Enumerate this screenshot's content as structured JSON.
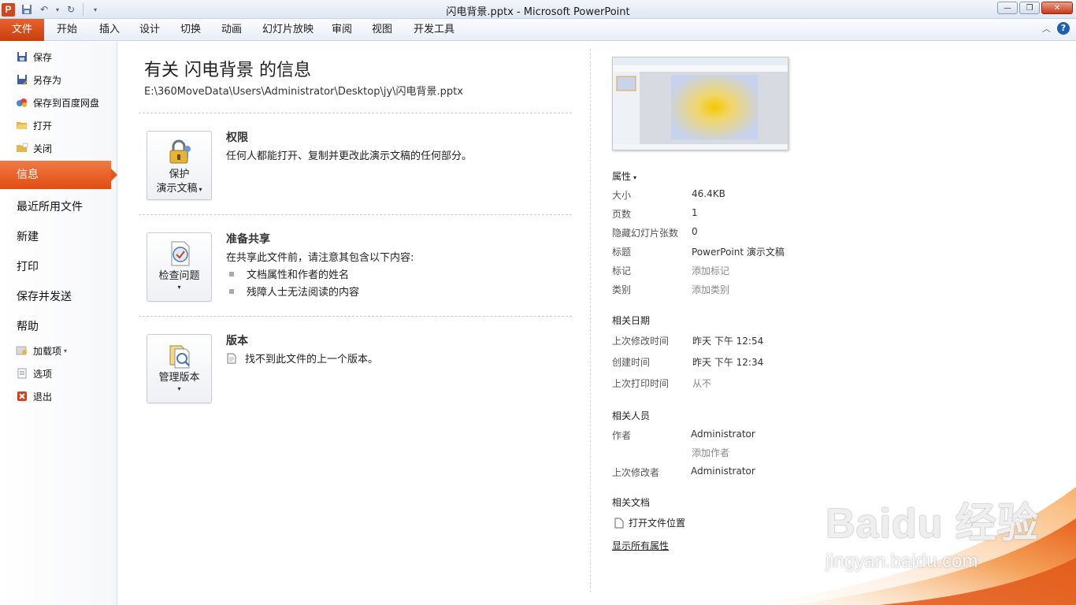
{
  "window": {
    "title": "闪电背景.pptx  -  Microsoft PowerPoint",
    "app_icon_letter": "P"
  },
  "ribbon": {
    "file_tab": "文件",
    "tabs": [
      "开始",
      "插入",
      "设计",
      "切换",
      "动画",
      "幻灯片放映",
      "审阅",
      "视图",
      "开发工具"
    ]
  },
  "leftnav": {
    "small_top": [
      {
        "label": "保存",
        "icon": "save-icon"
      },
      {
        "label": "另存为",
        "icon": "save-as-icon"
      },
      {
        "label": "保存到百度网盘",
        "icon": "baidu-cloud-icon"
      },
      {
        "label": "打开",
        "icon": "open-folder-icon"
      },
      {
        "label": "关闭",
        "icon": "close-folder-icon"
      }
    ],
    "active": "信息",
    "big": [
      "最近所用文件",
      "新建",
      "打印",
      "保存并发送",
      "帮助"
    ],
    "small_bottom": [
      {
        "label": "加载项",
        "icon": "addins-icon"
      },
      {
        "label": "选项",
        "icon": "options-icon"
      },
      {
        "label": "退出",
        "icon": "exit-icon"
      }
    ]
  },
  "info": {
    "heading": "有关 闪电背景 的信息",
    "path": "E:\\360MoveData\\Users\\Administrator\\Desktop\\jy\\闪电背景.pptx",
    "permissions": {
      "button_line1": "保护",
      "button_line2": "演示文稿",
      "title": "权限",
      "text": "任何人都能打开、复制并更改此演示文稿的任何部分。"
    },
    "share": {
      "button": "检查问题",
      "title": "准备共享",
      "text": "在共享此文件前，请注意其包含以下内容:",
      "bullets": [
        "文档属性和作者的姓名",
        "残障人士无法阅读的内容"
      ]
    },
    "versions": {
      "button": "管理版本",
      "title": "版本",
      "text": "找不到此文件的上一个版本。"
    }
  },
  "properties": {
    "header": "属性",
    "rows": [
      {
        "label": "大小",
        "value": "46.4KB"
      },
      {
        "label": "页数",
        "value": "1"
      },
      {
        "label": "隐藏幻灯片张数",
        "value": "0"
      },
      {
        "label": "标题",
        "value": "PowerPoint 演示文稿"
      },
      {
        "label": "标记",
        "value": "添加标记"
      },
      {
        "label": "类别",
        "value": "添加类别"
      }
    ],
    "dates_header": "相关日期",
    "dates": [
      {
        "label": "上次修改时间",
        "value": "昨天 下午 12:54"
      },
      {
        "label": "创建时间",
        "value": "昨天 下午 12:34"
      },
      {
        "label": "上次打印时间",
        "value": "从不"
      }
    ],
    "people_header": "相关人员",
    "author_label": "作者",
    "author_value": "Administrator",
    "add_author": "添加作者",
    "modified_by_label": "上次修改者",
    "modified_by_value": "Administrator",
    "docs_header": "相关文档",
    "open_location": "打开文件位置",
    "show_all": "显示所有属性"
  },
  "watermark": {
    "logo": "Baidu 经验",
    "url": "jingyan.baidu.com"
  },
  "colors": {
    "accent": "#e04d13",
    "ribbon_bg": "#e8eef7"
  }
}
